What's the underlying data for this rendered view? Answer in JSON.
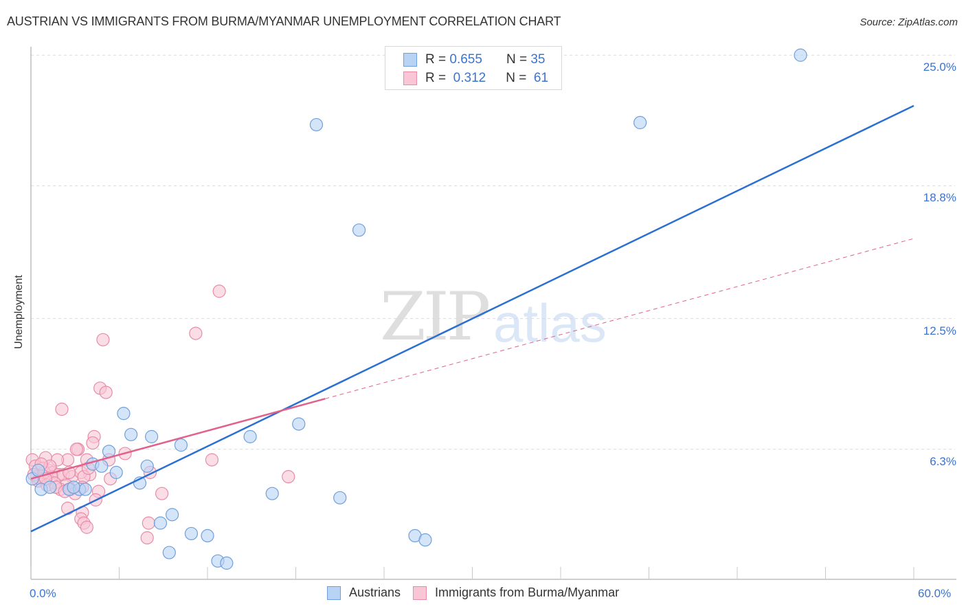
{
  "title": "AUSTRIAN VS IMMIGRANTS FROM BURMA/MYANMAR UNEMPLOYMENT CORRELATION CHART",
  "source": "Source: ZipAtlas.com",
  "watermark": {
    "zip": "ZIP",
    "atlas": "atlas"
  },
  "legend_top": [
    {
      "r_label": "R =",
      "r_value": "0.655",
      "n_label": "N =",
      "n_value": "35"
    },
    {
      "r_label": "R =",
      "r_value": "0.312",
      "n_label": "N =",
      "n_value": "61"
    }
  ],
  "legend_bottom": [
    "Austrians",
    "Immigrants from Burma/Myanmar"
  ],
  "colors": {
    "blue_fill": "#b9d3f5",
    "blue_stroke": "#6f9fdc",
    "blue_line": "#2a6fd1",
    "pink_fill": "#f9c6d5",
    "pink_stroke": "#e88ba8",
    "pink_line": "#e0618a",
    "tick_text": "#3b74cc"
  },
  "chart_data": {
    "type": "scatter",
    "title": "AUSTRIAN VS IMMIGRANTS FROM BURMA/MYANMAR UNEMPLOYMENT CORRELATION CHART",
    "xlabel": "",
    "ylabel": "Unemployment",
    "xlim": [
      0,
      60
    ],
    "ylim": [
      0,
      25.5
    ],
    "x_tick_labels": [
      "0.0%",
      "60.0%"
    ],
    "y_ticks": [
      6.3,
      12.5,
      18.8,
      25.0
    ],
    "y_tick_labels": [
      "6.3%",
      "12.5%",
      "18.8%",
      "25.0%"
    ],
    "grid": "horizontal dashed",
    "legend_placement": "top-center",
    "series": [
      {
        "name": "Austrians",
        "R": 0.655,
        "N": 35,
        "trend": {
          "x": [
            0,
            60
          ],
          "y": [
            2.4,
            22.6
          ],
          "style": "solid"
        },
        "points": [
          [
            52.3,
            25.0
          ],
          [
            19.4,
            21.7
          ],
          [
            41.4,
            21.8
          ],
          [
            22.3,
            16.7
          ],
          [
            6.3,
            8.0
          ],
          [
            18.2,
            7.5
          ],
          [
            6.8,
            7.0
          ],
          [
            8.2,
            6.9
          ],
          [
            14.9,
            6.9
          ],
          [
            10.2,
            6.5
          ],
          [
            5.3,
            6.2
          ],
          [
            4.2,
            5.6
          ],
          [
            4.8,
            5.5
          ],
          [
            7.9,
            5.5
          ],
          [
            5.8,
            5.2
          ],
          [
            7.4,
            4.7
          ],
          [
            16.4,
            4.2
          ],
          [
            21.0,
            4.0
          ],
          [
            0.7,
            4.4
          ],
          [
            1.3,
            4.5
          ],
          [
            2.6,
            4.4
          ],
          [
            3.3,
            4.4
          ],
          [
            3.7,
            4.4
          ],
          [
            9.6,
            3.2
          ],
          [
            8.8,
            2.8
          ],
          [
            10.9,
            2.3
          ],
          [
            12.0,
            2.2
          ],
          [
            26.1,
            2.2
          ],
          [
            26.8,
            2.0
          ],
          [
            9.4,
            1.4
          ],
          [
            12.7,
            1.0
          ],
          [
            13.3,
            0.9
          ],
          [
            0.1,
            4.9
          ],
          [
            0.5,
            5.3
          ],
          [
            2.9,
            4.5
          ]
        ]
      },
      {
        "name": "Immigrants from Burma/Myanmar",
        "R": 0.312,
        "N": 61,
        "trend": {
          "x": [
            0,
            20
          ],
          "y": [
            4.9,
            8.7
          ],
          "style": "solid",
          "extension": {
            "x": [
              20,
              60
            ],
            "y": [
              8.7,
              16.3
            ],
            "style": "dashed"
          }
        },
        "points": [
          [
            12.8,
            13.8
          ],
          [
            11.2,
            11.8
          ],
          [
            4.9,
            11.5
          ],
          [
            4.7,
            9.2
          ],
          [
            5.1,
            9.0
          ],
          [
            2.1,
            8.2
          ],
          [
            4.3,
            6.9
          ],
          [
            4.2,
            6.6
          ],
          [
            3.2,
            6.3
          ],
          [
            3.1,
            6.3
          ],
          [
            6.4,
            6.1
          ],
          [
            5.3,
            5.8
          ],
          [
            12.3,
            5.8
          ],
          [
            3.8,
            5.8
          ],
          [
            2.5,
            5.8
          ],
          [
            0.1,
            5.8
          ],
          [
            1.0,
            5.9
          ],
          [
            1.8,
            5.8
          ],
          [
            4.0,
            5.1
          ],
          [
            17.5,
            5.0
          ],
          [
            0.3,
            5.5
          ],
          [
            0.8,
            5.4
          ],
          [
            1.2,
            5.3
          ],
          [
            1.5,
            5.2
          ],
          [
            1.9,
            5.1
          ],
          [
            0.4,
            5.0
          ],
          [
            0.6,
            4.9
          ],
          [
            1.4,
            5.0
          ],
          [
            2.2,
            5.1
          ],
          [
            2.8,
            5.0
          ],
          [
            3.4,
            5.2
          ],
          [
            3.6,
            5.0
          ],
          [
            0.2,
            5.1
          ],
          [
            0.9,
            5.2
          ],
          [
            1.6,
            4.7
          ],
          [
            2.4,
            4.6
          ],
          [
            2.0,
            4.4
          ],
          [
            2.7,
            4.4
          ],
          [
            3.0,
            4.2
          ],
          [
            0.5,
            4.8
          ],
          [
            1.1,
            4.6
          ],
          [
            1.7,
            4.5
          ],
          [
            2.3,
            4.3
          ],
          [
            3.5,
            4.5
          ],
          [
            4.6,
            4.3
          ],
          [
            8.1,
            5.2
          ],
          [
            4.4,
            3.9
          ],
          [
            2.5,
            3.5
          ],
          [
            3.5,
            3.3
          ],
          [
            3.4,
            3.0
          ],
          [
            3.6,
            2.8
          ],
          [
            3.8,
            2.6
          ],
          [
            8.0,
            2.8
          ],
          [
            7.9,
            2.1
          ],
          [
            8.9,
            4.2
          ],
          [
            1.3,
            5.5
          ],
          [
            0.7,
            5.6
          ],
          [
            5.4,
            4.9
          ],
          [
            2.6,
            5.2
          ],
          [
            1.0,
            4.9
          ],
          [
            3.9,
            5.4
          ]
        ]
      }
    ]
  }
}
